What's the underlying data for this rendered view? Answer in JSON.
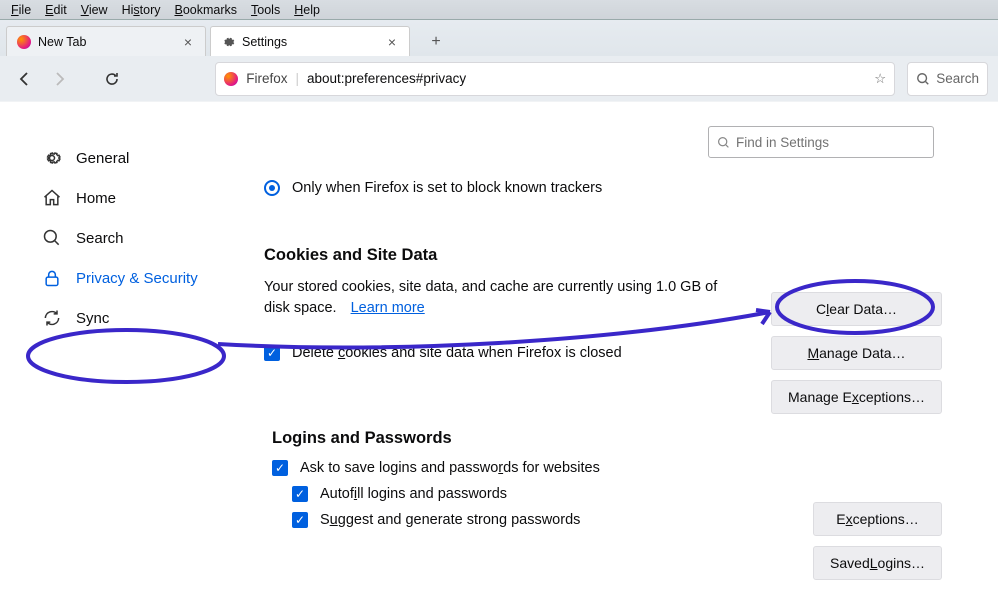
{
  "menubar": [
    "File",
    "Edit",
    "View",
    "History",
    "Bookmarks",
    "Tools",
    "Help"
  ],
  "tabs": [
    {
      "label": "New Tab",
      "active": false
    },
    {
      "label": "Settings",
      "active": true
    }
  ],
  "urlbar": {
    "brand": "Firefox",
    "url": "about:preferences#privacy"
  },
  "searchbar_placeholder": "Search",
  "sidebar": {
    "items": [
      {
        "label": "General"
      },
      {
        "label": "Home"
      },
      {
        "label": "Search"
      },
      {
        "label": "Privacy & Security"
      },
      {
        "label": "Sync"
      }
    ]
  },
  "find_placeholder": "Find in Settings",
  "radio_label": "Only when Firefox is set to block known trackers",
  "cookies": {
    "heading": "Cookies and Site Data",
    "para": "Your stored cookies, site data, and cache are currently using 1.0 GB of disk space.",
    "learn": "Learn more",
    "buttons": [
      "Clear Data…",
      "Manage Data…",
      "Manage Exceptions…"
    ],
    "cb_delete": "Delete cookies and site data when Firefox is closed"
  },
  "logins": {
    "heading": "Logins and Passwords",
    "cb_ask": "Ask to save logins and passwords for websites",
    "cb_autofill": "Autofill logins and passwords",
    "cb_suggest": "Suggest and generate strong passwords",
    "buttons": [
      "Exceptions…",
      "Saved Logins…"
    ]
  }
}
